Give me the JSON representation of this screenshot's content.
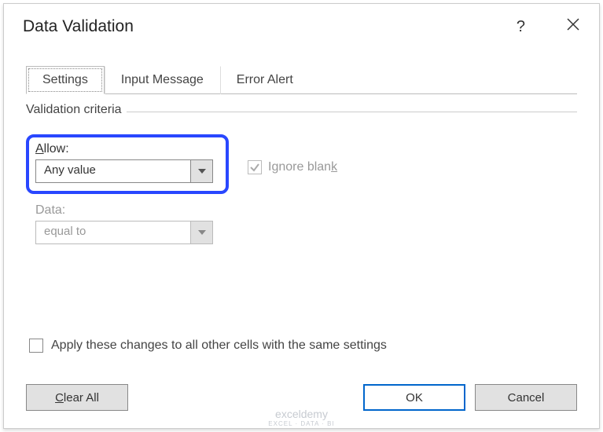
{
  "dialog": {
    "title": "Data Validation",
    "help_symbol": "?",
    "tabs": [
      {
        "label": "Settings",
        "active": true
      },
      {
        "label": "Input Message",
        "active": false
      },
      {
        "label": "Error Alert",
        "active": false
      }
    ],
    "criteria": {
      "legend": "Validation criteria",
      "allow": {
        "label_pre": "A",
        "label_post": "llow:",
        "value": "Any value"
      },
      "ignore_blank": {
        "label": "Ignore blan",
        "label_post": "k",
        "checked": true,
        "disabled": true
      },
      "data": {
        "label": "Data:",
        "value": "equal to",
        "disabled": true
      }
    },
    "apply_all": {
      "label": "Apply these changes to all other cells with the same settings",
      "checked": false
    },
    "buttons": {
      "clear_pre": "C",
      "clear_post": "lear All",
      "ok": "OK",
      "cancel": "Cancel"
    }
  },
  "watermark": {
    "main": "exceldemy",
    "sub": "EXCEL · DATA · BI"
  }
}
